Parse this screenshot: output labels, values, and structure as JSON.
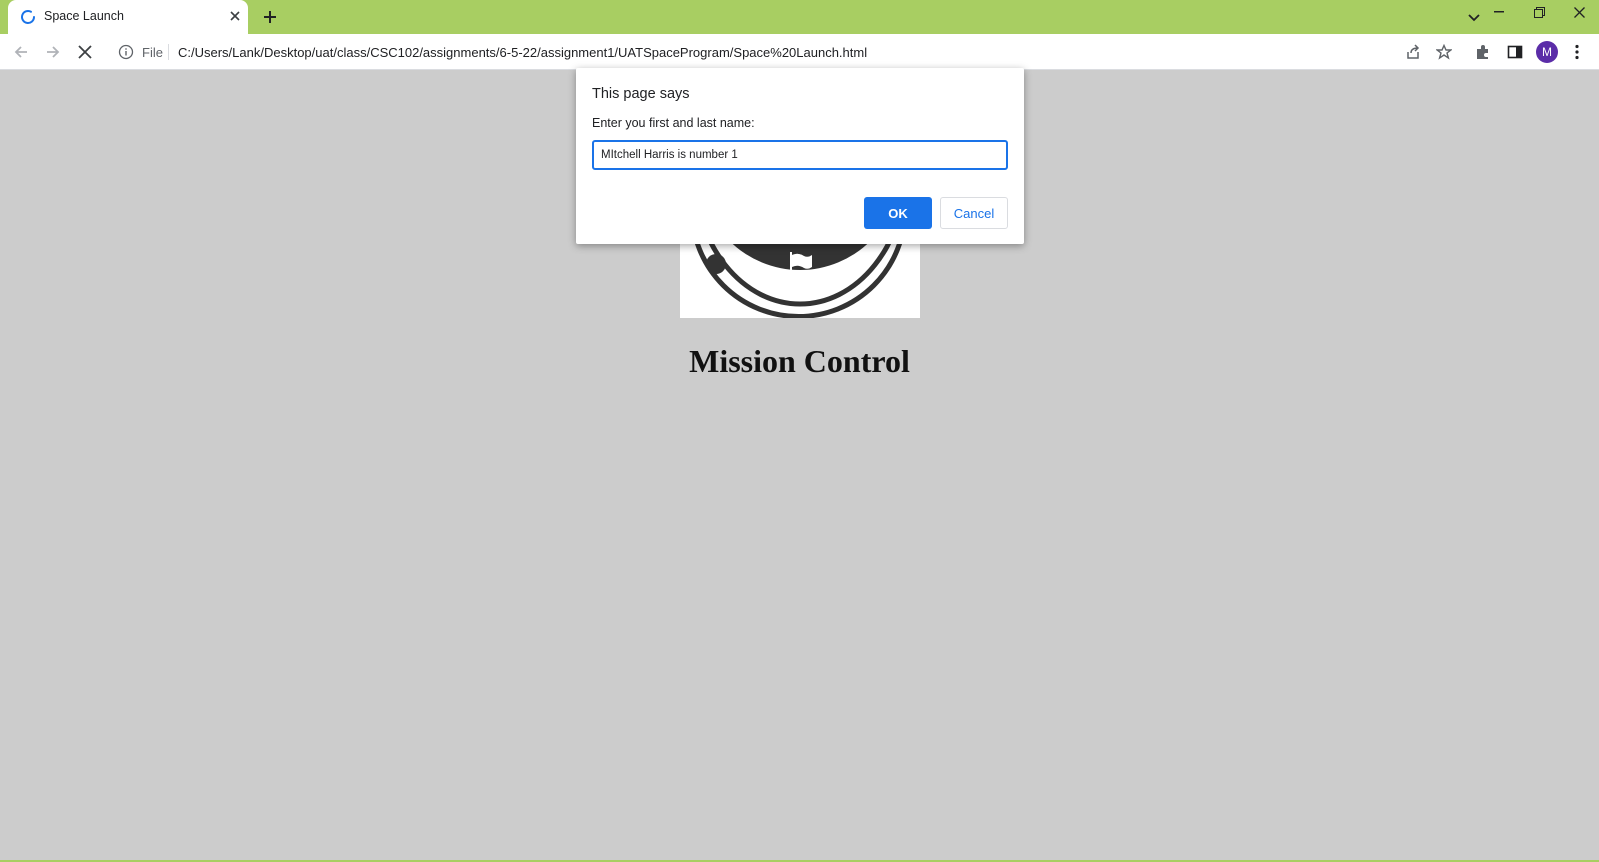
{
  "browser": {
    "tab": {
      "title": "Space Launch",
      "loading": true
    },
    "window_frame_color": "#a8ce62",
    "address_bar": {
      "scheme_label": "File",
      "url": "C:/Users/Lank/Desktop/uat/class/CSC102/assignments/6-5-22/assignment1/UATSpaceProgram/Space%20Launch.html"
    },
    "profile_initial": "M",
    "profile_color": "#5b2da8"
  },
  "page": {
    "title": "Mission Control",
    "background": "#cccccc"
  },
  "dialog": {
    "header": "This page says",
    "message": "Enter you first and last name:",
    "input_value": "MItchell Harris is number 1",
    "ok_label": "OK",
    "cancel_label": "Cancel",
    "accent": "#1a73e8"
  }
}
